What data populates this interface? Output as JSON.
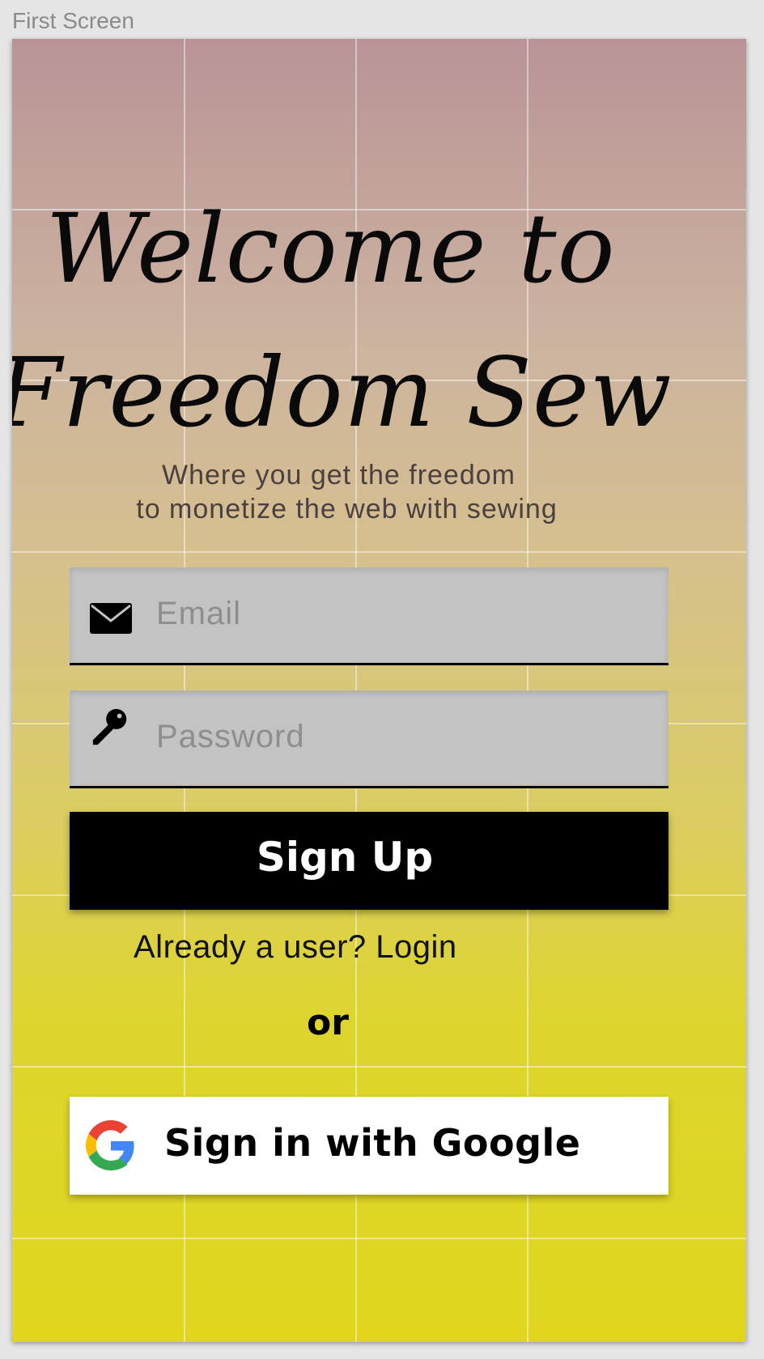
{
  "frame": {
    "label": "First Screen"
  },
  "hero": {
    "title_line1": "Welcome to",
    "title_line2": "Freedom Sew",
    "tagline_line1": "Where you get the freedom",
    "tagline_line2": "to monetize the web with sewing"
  },
  "form": {
    "email": {
      "placeholder": "Email",
      "icon": "envelope-icon"
    },
    "password": {
      "placeholder": "Password",
      "icon": "key-icon"
    },
    "signup_label": "Sign Up",
    "login_prompt": "Already a user? Login",
    "or_label": "or",
    "google_label": "Sign in with Google",
    "google_icon": "google-g-icon"
  },
  "colors": {
    "gradient_top": "#b99396",
    "gradient_bottom": "#dfd61c",
    "field_bg": "#c3c3c3",
    "primary_button": "#000000",
    "google_button": "#ffffff"
  }
}
